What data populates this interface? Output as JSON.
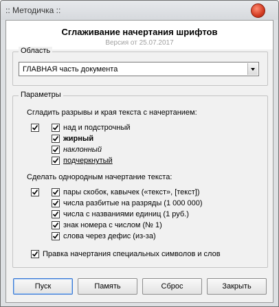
{
  "window": {
    "title": ":: Методичка ::",
    "close_color": "#d23b22"
  },
  "header": {
    "title": "Сглаживание начертания шрифтов",
    "version": "Версия от  25.07.2017"
  },
  "area": {
    "label": "Область",
    "selected": "ГЛАВНАЯ часть документа"
  },
  "params": {
    "label": "Параметры",
    "section1": {
      "label": "Сгладить разрывы и края текста с начертанием:",
      "master_checked": true,
      "items": [
        {
          "label": "над и подстрочный",
          "checked": true
        },
        {
          "label": "жирный",
          "checked": true
        },
        {
          "label": "наклонный",
          "checked": true
        },
        {
          "label": "подчеркнутый",
          "checked": true
        }
      ]
    },
    "section2": {
      "label": "Сделать однородным начертание текста:",
      "master_checked": true,
      "items": [
        {
          "label": "пары скобок, кавычек («текст», [текст])",
          "checked": true
        },
        {
          "label": "числа разбитые на разряды (1 000 000)",
          "checked": true
        },
        {
          "label": "числа с названиями единиц (1 руб.)",
          "checked": true
        },
        {
          "label": "знак номера с числом (№ 1)",
          "checked": true
        },
        {
          "label": "слова через дефис (из-за)",
          "checked": true
        }
      ]
    },
    "special": {
      "label": "Правка начертания специальных символов и слов",
      "checked": true
    }
  },
  "buttons": {
    "start": "Пуск",
    "memory": "Память",
    "reset": "Сброс",
    "close": "Закрыть"
  }
}
